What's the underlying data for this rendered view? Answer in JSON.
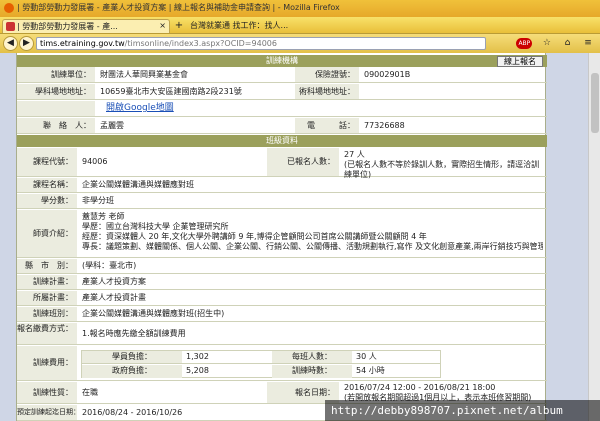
{
  "browser": {
    "window_title": "| 勞動部勞動力發展署 - 產業人才投資方案 | 線上報名與補助金申請查詢 | - Mozilla Firefox",
    "tab_title": "| 勞動部勞動力發展署 - 產...",
    "tab_close": "×",
    "tab_new": "+",
    "bookmark_text": "台灣就業通 找工作：找人...",
    "url_domain": "tims.etraining.gov.tw",
    "url_path": "/timsonline/index3.aspx?OCID=94006",
    "nav_back": "◀",
    "nav_forward": "▶",
    "abp_label": "ABP"
  },
  "section_org": {
    "band_label": "訓練機構",
    "signup_label": "線上報名"
  },
  "org": {
    "unit_label": "訓練單位：",
    "unit_value": "財團法人華岡興業基金會",
    "insurance_label": "保險證號：",
    "insurance_value": "09002901B",
    "class_addr_label": "學科場地地址：",
    "class_addr_value": "10659臺北市大安區建國南路2段231號",
    "tech_addr_label": "術科場地地址：",
    "tech_addr_value": "",
    "map_link": "開啟Google地圖",
    "contact_label": "聯　絡　人：",
    "contact_value": "孟麗雲",
    "phone_label": "電　　　話：",
    "phone_value": "77326688"
  },
  "section_course": {
    "band_label": "班級資料"
  },
  "course": {
    "code_label": "課程代號：",
    "code_value": "94006",
    "enrolled_label": "已報名人數：",
    "enrolled_value": "27 人",
    "enrolled_note": "(已報名人數不等於錄訓人數，實際招生情形，請逕洽訓練單位)",
    "name_label": "課程名稱：",
    "name_value": "企業公關媒體溝通與媒體應對班",
    "credits_label": "學分數：",
    "credits_value": "非學分班",
    "teacher_label": "師資介紹：",
    "teacher_lines": [
      "蓋慧芳 老師",
      "學歷：國立台灣科技大學 企業管理研究所",
      "經歷：資深媒體人 20 年,文化大學外聘講師 9 年,博得企管顧問公司首席公關講師暨公關顧問 4 年",
      "專長：議題策劃、媒體關係、個人公關、企業公關、行銷公關、公關傳播、活動規劃執行,寫作 及文化創意產業,兩岸行銷技巧與管理"
    ],
    "area_label": "縣　市　別：",
    "area_value": "(學科：臺北市)",
    "plan_label": "訓練計畫：",
    "plan_value": "產業人才投資方案",
    "sub_plan_label": "所屬計畫：",
    "sub_plan_value": "產業人才投資計畫",
    "class_label": "訓練班別：",
    "class_value": "企業公關媒體溝通與媒體應對班(招生中)",
    "payment_label": "報名繳費方式：",
    "payment_value": "1.報名時應先繳全額訓練費用",
    "fee_label": "訓練費用：",
    "fee_table": {
      "student_label": "學員負擔：",
      "student_value": "1,302",
      "class_size_label": "每班人數：",
      "class_size_value": "30 人",
      "gov_label": "政府負擔：",
      "gov_value": "5,208",
      "hours_label": "訓練時數：",
      "hours_value": "54 小時"
    },
    "nature_label": "訓練性質：",
    "nature_value": "在職",
    "signup_date_label": "報名日期：",
    "signup_date_value": "2016/07/24 12:00 - 2016/08/21 18:00",
    "signup_date_note": "(若開放報名期間超過1個月以上，表示本班修習期間)",
    "period_label": "預定訓練起迄日期：",
    "period_value": "2016/08/24 - 2016/10/26"
  },
  "watermark": "http://debby898707.pixnet.net/album",
  "colors": {
    "band": "#9ba05c",
    "label_bg": "#ebecdf",
    "link": "#1a4fb6",
    "titlebar": "#e6a82a"
  }
}
